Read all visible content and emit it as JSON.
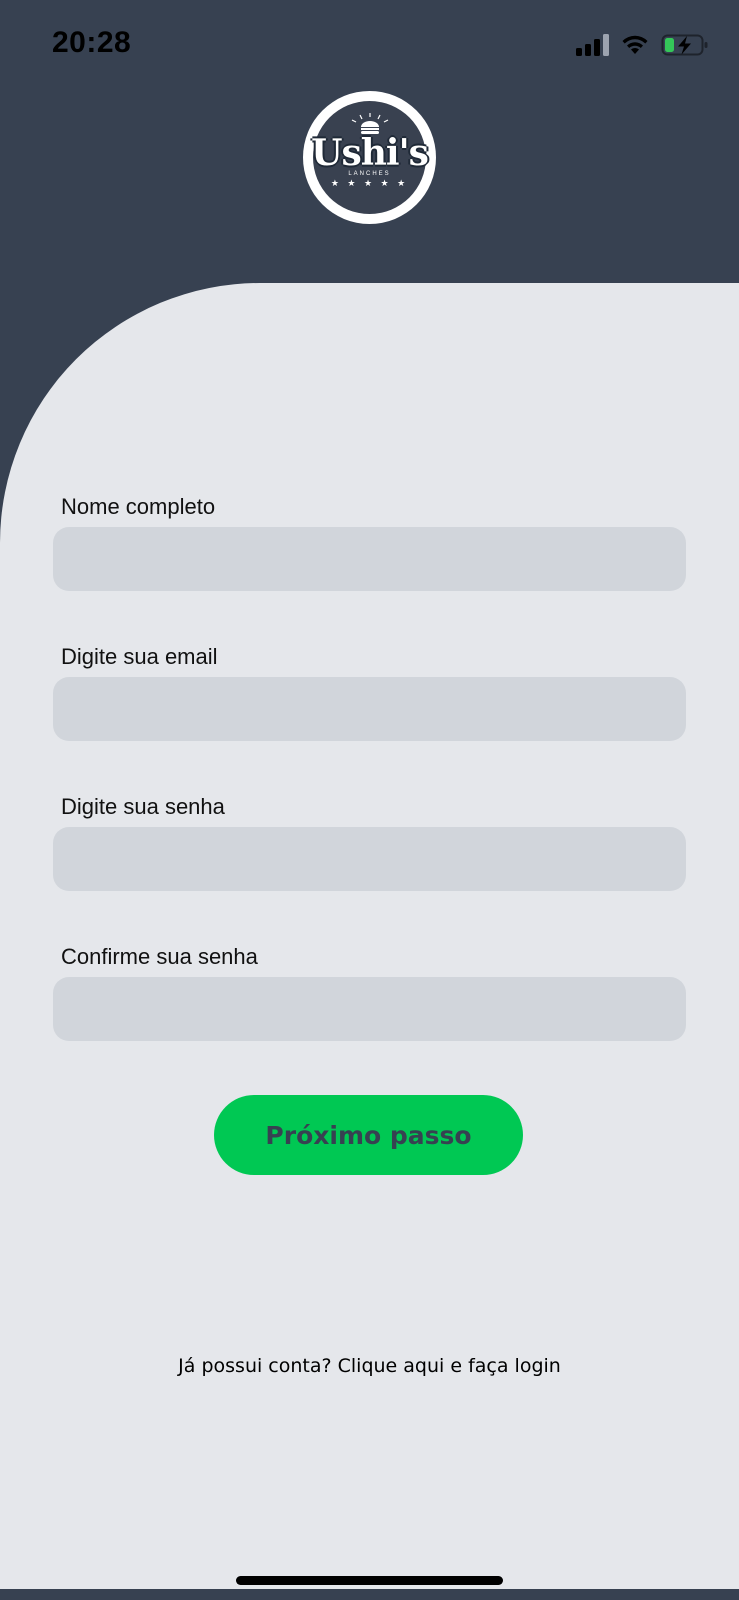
{
  "status_bar": {
    "time": "20:28",
    "icons": [
      "signal-icon",
      "wifi-icon",
      "battery-charging-icon"
    ]
  },
  "logo": {
    "brand": "Ushi's",
    "sub": "LANCHES",
    "stars": "★ ★ ★ ★ ★"
  },
  "form": {
    "fields": [
      {
        "label": "Nome completo",
        "value": ""
      },
      {
        "label": "Digite sua email",
        "value": ""
      },
      {
        "label": "Digite sua senha",
        "value": ""
      },
      {
        "label": "Confirme sua senha",
        "value": ""
      }
    ],
    "submit_label": "Próximo passo"
  },
  "footer": {
    "login_text": "Já possui conta? Clique aqui e faça login"
  },
  "colors": {
    "header_bg": "#374151",
    "card_bg": "#e5e7eb",
    "input_bg": "#d1d5db",
    "accent": "#00c853",
    "button_text": "#374151"
  }
}
